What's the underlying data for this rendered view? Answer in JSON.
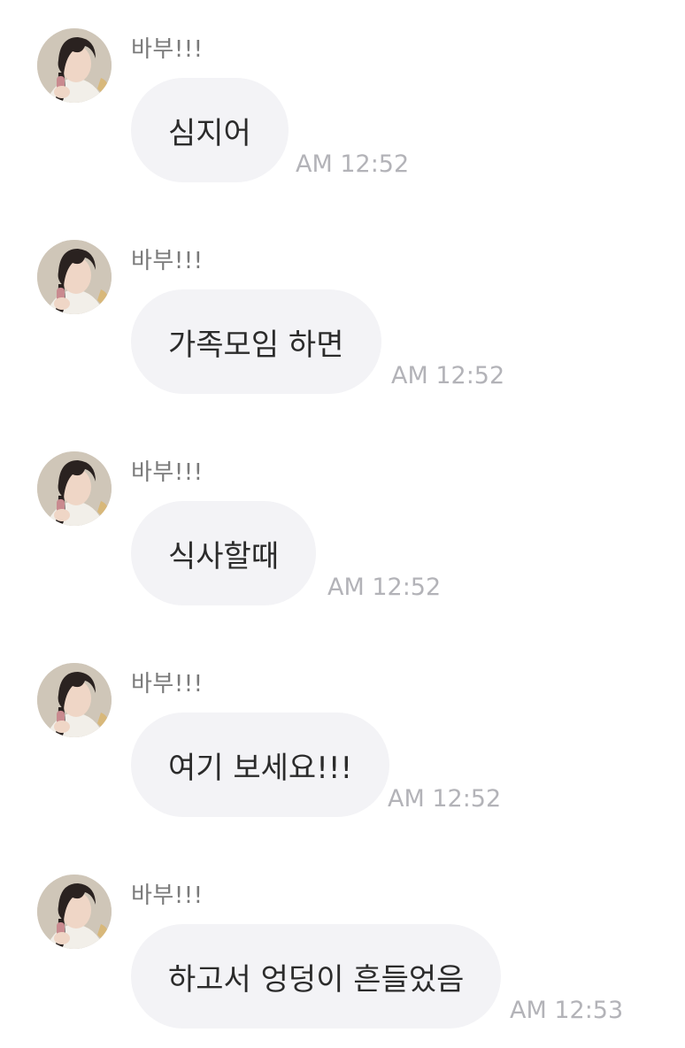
{
  "messages": [
    {
      "sender": "바부!!!",
      "text": "심지어",
      "time": "AM 12:52"
    },
    {
      "sender": "바부!!!",
      "text": "가족모임 하면",
      "time": "AM 12:52"
    },
    {
      "sender": "바부!!!",
      "text": "식사할때",
      "time": "AM 12:52"
    },
    {
      "sender": "바부!!!",
      "text": "여기 보세요!!!",
      "time": "AM 12:52"
    },
    {
      "sender": "바부!!!",
      "text": "하고서 엉덩이 흔들었음",
      "time": "AM 12:53"
    }
  ],
  "colors": {
    "bubble": "#f3f3f6",
    "text": "#2b2b2b",
    "sender": "#7a7a7a",
    "time": "#b3b3b8"
  }
}
